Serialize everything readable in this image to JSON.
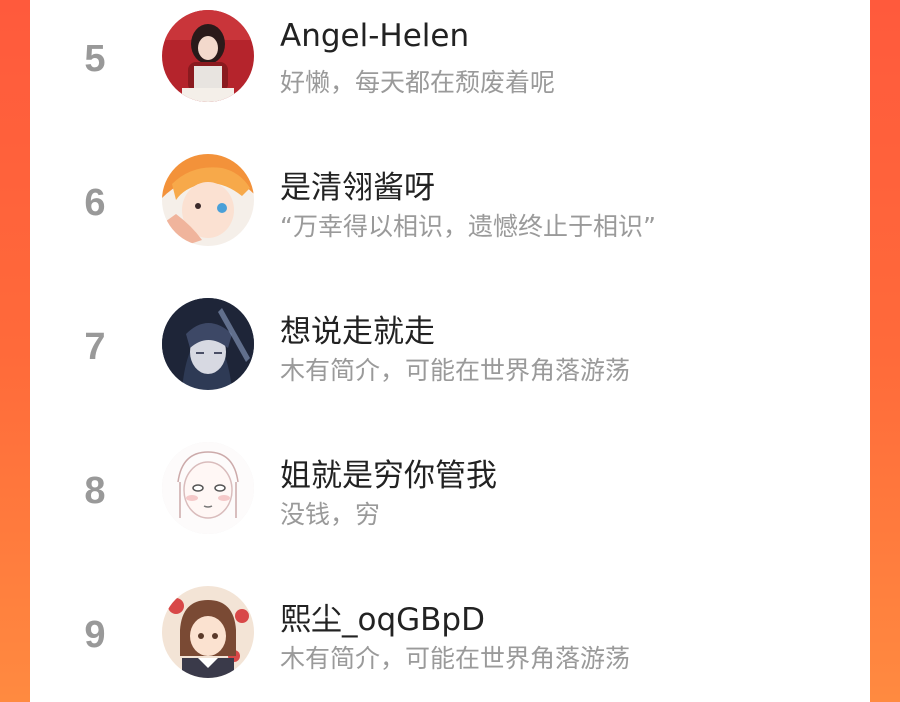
{
  "ranking": {
    "items": [
      {
        "rank": "5",
        "name": "Angel-Helen",
        "bio": "好懒，每天都在颓废着呢",
        "avatar_icon": "avatar-girl-red-outfit-icon"
      },
      {
        "rank": "6",
        "name": "是清翎酱呀",
        "bio": "“万幸得以相识，遗憾终止于相识”",
        "avatar_icon": "avatar-orange-hair-anime-icon"
      },
      {
        "rank": "7",
        "name": "想说走就走",
        "bio": "木有简介，可能在世界角落游荡",
        "avatar_icon": "avatar-dark-hair-anime-icon"
      },
      {
        "rank": "8",
        "name": "姐就是穷你管我",
        "bio": "没钱，穷",
        "avatar_icon": "avatar-sketch-face-icon"
      },
      {
        "rank": "9",
        "name": "熙尘_oqGBpD",
        "bio": "木有简介，可能在世界角落游荡",
        "avatar_icon": "avatar-brown-hair-girl-icon"
      }
    ]
  },
  "colors": {
    "background_gradient_top": "#ff5a3c",
    "background_gradient_bottom": "#ff8a40",
    "card": "#ffffff",
    "rank_text": "#999999",
    "name_text": "#222222",
    "bio_text": "#9a9a9a"
  }
}
